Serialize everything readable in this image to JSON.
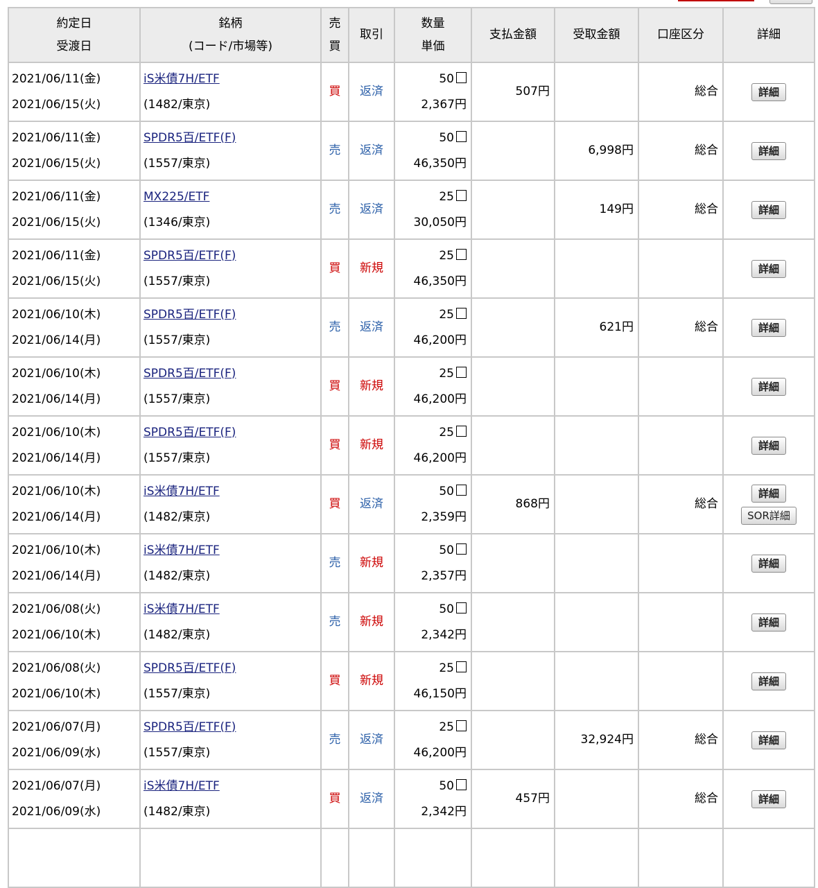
{
  "headers": {
    "date1": "約定日",
    "date2": "受渡日",
    "name1": "銘柄",
    "name2": "(コード/市場等)",
    "side1": "売",
    "side2": "買",
    "type": "取引",
    "qty1": "数量",
    "qty2": "単価",
    "pay": "支払金額",
    "recv": "受取金額",
    "acct": "口座区分",
    "detail": "詳細"
  },
  "buttons": {
    "detail": "詳細",
    "sor_detail": "SOR詳細"
  },
  "rows": [
    {
      "trade_date": "2021/06/11(金)",
      "settle_date": "2021/06/15(火)",
      "name": "iS米債7H/ETF",
      "code": "(1482/東京)",
      "side": "買",
      "type": "返済",
      "qty": "50",
      "qty_unit": "口",
      "price": "2,367円",
      "pay": "507円",
      "recv": "",
      "account": "総合",
      "sor": false
    },
    {
      "trade_date": "2021/06/11(金)",
      "settle_date": "2021/06/15(火)",
      "name": "SPDR5百/ETF(F)",
      "code": "(1557/東京)",
      "side": "売",
      "type": "返済",
      "qty": "50",
      "qty_unit": "口",
      "price": "46,350円",
      "pay": "",
      "recv": "6,998円",
      "account": "総合",
      "sor": false
    },
    {
      "trade_date": "2021/06/11(金)",
      "settle_date": "2021/06/15(火)",
      "name": "MX225/ETF",
      "code": "(1346/東京)",
      "side": "売",
      "type": "返済",
      "qty": "25",
      "qty_unit": "口",
      "price": "30,050円",
      "pay": "",
      "recv": "149円",
      "account": "総合",
      "sor": false
    },
    {
      "trade_date": "2021/06/11(金)",
      "settle_date": "2021/06/15(火)",
      "name": "SPDR5百/ETF(F)",
      "code": "(1557/東京)",
      "side": "買",
      "type": "新規",
      "qty": "25",
      "qty_unit": "口",
      "price": "46,350円",
      "pay": "",
      "recv": "",
      "account": "",
      "sor": false
    },
    {
      "trade_date": "2021/06/10(木)",
      "settle_date": "2021/06/14(月)",
      "name": "SPDR5百/ETF(F)",
      "code": "(1557/東京)",
      "side": "売",
      "type": "返済",
      "qty": "25",
      "qty_unit": "口",
      "price": "46,200円",
      "pay": "",
      "recv": "621円",
      "account": "総合",
      "sor": false
    },
    {
      "trade_date": "2021/06/10(木)",
      "settle_date": "2021/06/14(月)",
      "name": "SPDR5百/ETF(F)",
      "code": "(1557/東京)",
      "side": "買",
      "type": "新規",
      "qty": "25",
      "qty_unit": "口",
      "price": "46,200円",
      "pay": "",
      "recv": "",
      "account": "",
      "sor": false
    },
    {
      "trade_date": "2021/06/10(木)",
      "settle_date": "2021/06/14(月)",
      "name": "SPDR5百/ETF(F)",
      "code": "(1557/東京)",
      "side": "買",
      "type": "新規",
      "qty": "25",
      "qty_unit": "口",
      "price": "46,200円",
      "pay": "",
      "recv": "",
      "account": "",
      "sor": false
    },
    {
      "trade_date": "2021/06/10(木)",
      "settle_date": "2021/06/14(月)",
      "name": "iS米債7H/ETF",
      "code": "(1482/東京)",
      "side": "買",
      "type": "返済",
      "qty": "50",
      "qty_unit": "口",
      "price": "2,359円",
      "pay": "868円",
      "recv": "",
      "account": "総合",
      "sor": true
    },
    {
      "trade_date": "2021/06/10(木)",
      "settle_date": "2021/06/14(月)",
      "name": "iS米債7H/ETF",
      "code": "(1482/東京)",
      "side": "売",
      "type": "新規",
      "qty": "50",
      "qty_unit": "口",
      "price": "2,357円",
      "pay": "",
      "recv": "",
      "account": "",
      "sor": false
    },
    {
      "trade_date": "2021/06/08(火)",
      "settle_date": "2021/06/10(木)",
      "name": "iS米債7H/ETF",
      "code": "(1482/東京)",
      "side": "売",
      "type": "新規",
      "qty": "50",
      "qty_unit": "口",
      "price": "2,342円",
      "pay": "",
      "recv": "",
      "account": "",
      "sor": false
    },
    {
      "trade_date": "2021/06/08(火)",
      "settle_date": "2021/06/10(木)",
      "name": "SPDR5百/ETF(F)",
      "code": "(1557/東京)",
      "side": "買",
      "type": "新規",
      "qty": "25",
      "qty_unit": "口",
      "price": "46,150円",
      "pay": "",
      "recv": "",
      "account": "",
      "sor": false
    },
    {
      "trade_date": "2021/06/07(月)",
      "settle_date": "2021/06/09(水)",
      "name": "SPDR5百/ETF(F)",
      "code": "(1557/東京)",
      "side": "売",
      "type": "返済",
      "qty": "25",
      "qty_unit": "口",
      "price": "46,200円",
      "pay": "",
      "recv": "32,924円",
      "account": "総合",
      "sor": false
    },
    {
      "trade_date": "2021/06/07(月)",
      "settle_date": "2021/06/09(水)",
      "name": "iS米債7H/ETF",
      "code": "(1482/東京)",
      "side": "買",
      "type": "返済",
      "qty": "50",
      "qty_unit": "口",
      "price": "2,342円",
      "pay": "457円",
      "recv": "",
      "account": "総合",
      "sor": false
    }
  ]
}
